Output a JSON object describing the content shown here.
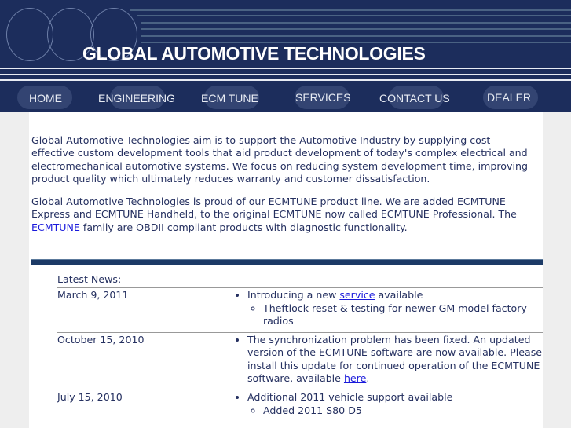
{
  "header": {
    "title": "GLOBAL AUTOMOTIVE TECHNOLOGIES"
  },
  "nav": [
    {
      "label": "HOME"
    },
    {
      "label": "ENGINEERING"
    },
    {
      "label": "ECM TUNE"
    },
    {
      "label": "SERVICES"
    },
    {
      "label": "CONTACT US"
    },
    {
      "label": "DEALER"
    }
  ],
  "intro": {
    "p1": "Global Automotive Technologies aim is to support the Automotive Industry by supplying cost effective custom development tools that aid product development of today's complex electrical and electromechanical automotive systems. We focus on reducing system development time, improving product quality which ultimately reduces warranty and customer dissatisfaction.",
    "p2_a": "Global Automotive Technologies is proud of our ECMTUNE product line.  We are added ECMTUNE Express and ECMTUNE Handheld, to the original ECMTUNE now called ECMTUNE Professional.  The ",
    "p2_link": "ECMTUNE",
    "p2_b": " family are OBDII compliant products with diagnostic functionality."
  },
  "news": {
    "heading": "Latest News:",
    "items": [
      {
        "date": "March 9, 2011",
        "text_a": "Introducing a new ",
        "link": "service",
        "text_b": " available",
        "sub": "Theftlock reset & testing for newer GM model factory radios"
      },
      {
        "date": "October 15, 2010",
        "text_a": "The synchronization problem has been fixed. An updated version of the ECMTUNE software are now available. Please install this update for continued operation of the ECMTUNE software, available ",
        "link": "here",
        "text_b": "."
      },
      {
        "date": "July 15, 2010",
        "text_a": "Additional 2011 vehicle support available",
        "sub": "Added 2011 S80 D5"
      }
    ]
  }
}
